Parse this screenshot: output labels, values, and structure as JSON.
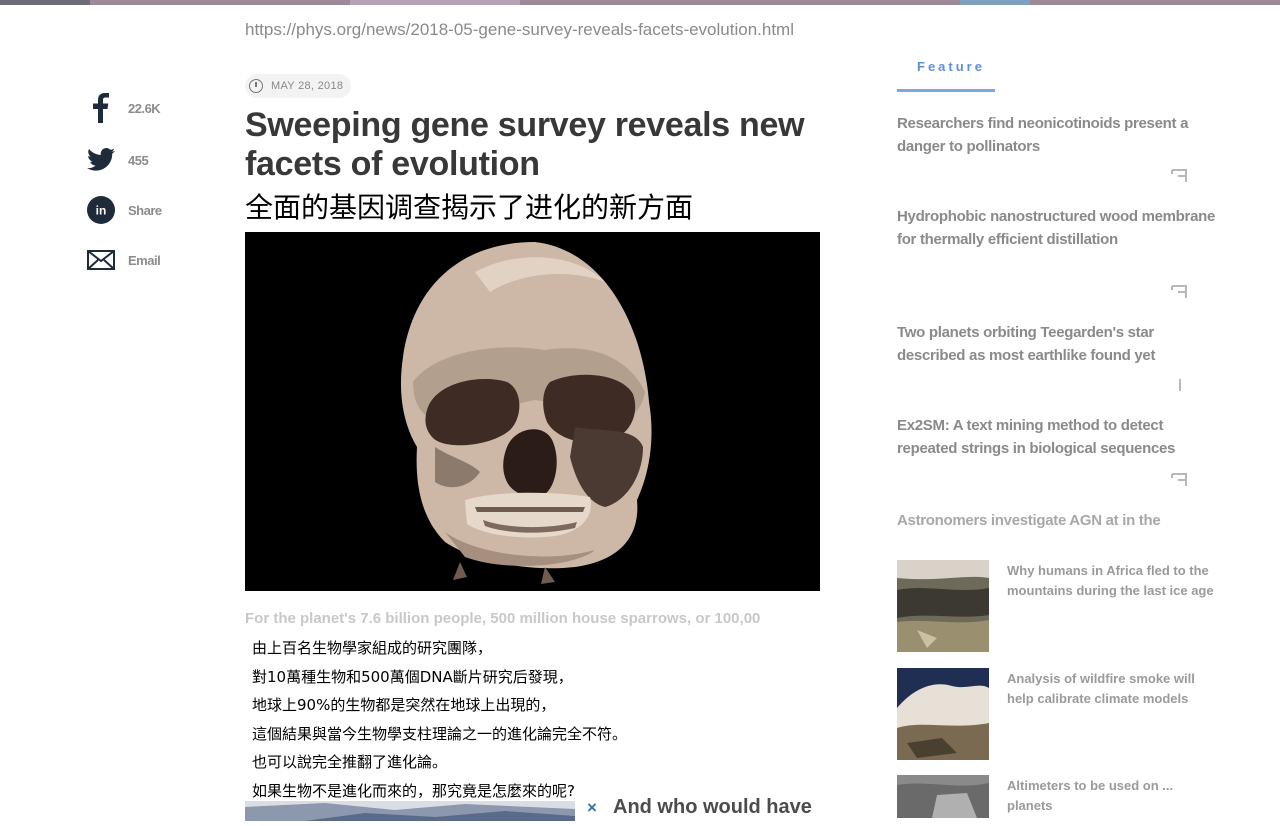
{
  "browser": {
    "url": "https://phys.org/news/2018-05-gene-survey-reveals-facets-evolution.html"
  },
  "share": {
    "items": [
      {
        "icon": "facebook-icon",
        "count": "22.6K"
      },
      {
        "icon": "twitter-icon",
        "count": "455"
      },
      {
        "icon": "linkedin-icon",
        "count": "Share"
      },
      {
        "icon": "email-icon",
        "count": "Email"
      }
    ]
  },
  "article": {
    "date": "MAY 28, 2018",
    "title": "Sweeping gene survey reveals new facets of evolution",
    "subtitle_zh": "全面的基因调查揭示了进化的新方面",
    "caption": "For the planet's 7.6 billion people, 500 million house sparrows, or 100,00",
    "overlay_lines": [
      "由上百名生物學家組成的研究團隊，",
      "對10萬種生物和500萬個DNA斷片研究后發現，",
      "地球上90%的生物都是突然在地球上出現的，",
      "這個結果與當今生物學支柱理論之一的進化論完全不符。",
      "也可以說完全推翻了進化論。",
      "如果生物不是進化而來的，那究竟是怎麼來的呢?"
    ],
    "ad_close": "×",
    "ad_text": "And who would have"
  },
  "sidebar": {
    "tab_label": "Feature",
    "news": [
      {
        "title": "Researchers find neonicotinoids present a danger to pollinators"
      },
      {
        "title": "Hydrophobic nanostructured wood membrane for thermally efficient distillation"
      },
      {
        "title": "Two planets orbiting Teegarden's star described as most earthlike found yet"
      },
      {
        "title": "Ex2SM: A text mining method to detect repeated strings in biological sequences"
      },
      {
        "title": "Astronomers investigate AGN at in the"
      }
    ],
    "thumbs": [
      {
        "title": "Why humans in Africa fled to the mountains during the last ice age"
      },
      {
        "title": "Analysis of wildfire smoke will help calibrate climate models"
      },
      {
        "title": "Altimeters to be used on ... planets"
      }
    ]
  },
  "colors": {
    "accent": "#5f8fd6",
    "social_icon": "#1f2b3a"
  }
}
